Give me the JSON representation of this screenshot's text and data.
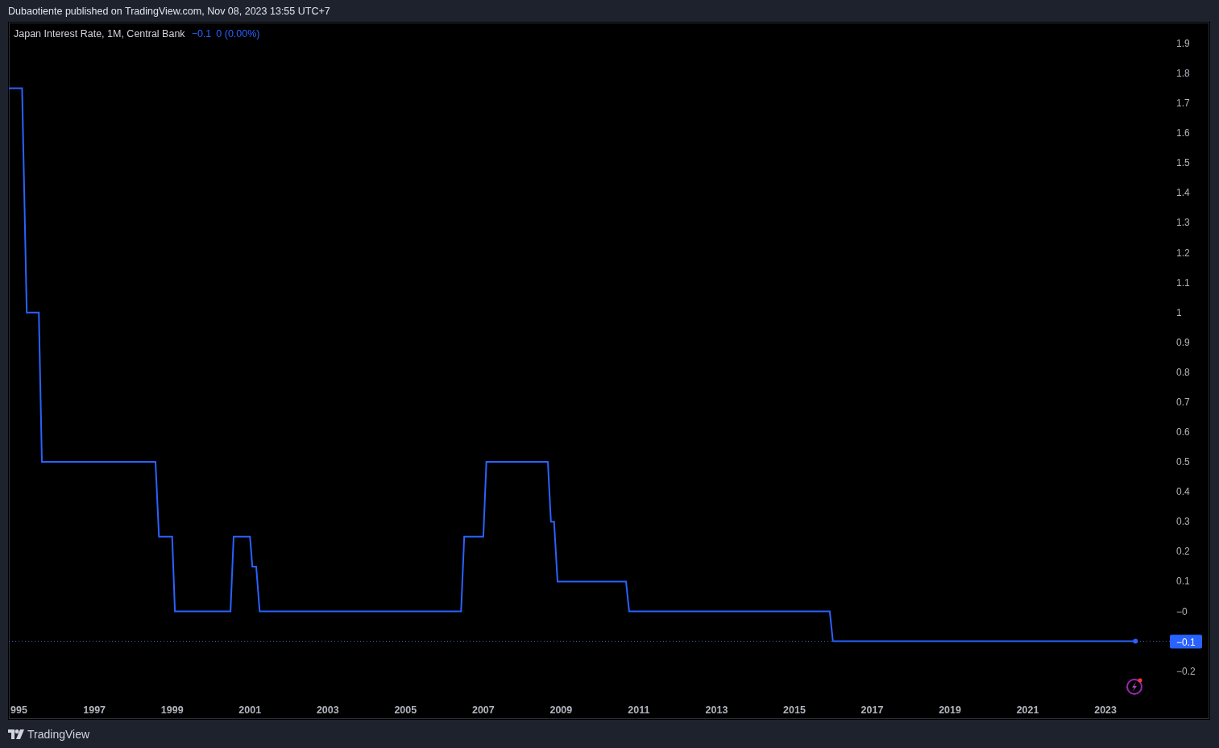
{
  "header": {
    "text": "Dubaotiente published on TradingView.com, Nov 08, 2023 13:55 UTC+7"
  },
  "legend": {
    "title": "Japan Interest Rate, 1M, Central Bank",
    "value": "−0.1",
    "change": "0 (0.00%)"
  },
  "chart": {
    "price_label": "−0.1",
    "cut_tick_label": "995",
    "chart_data": {
      "type": "line",
      "x": [
        1994.8,
        1995.14,
        1995.26,
        1995.57,
        1995.65,
        1998.57,
        1998.66,
        1999.0,
        1999.07,
        2000.5,
        2000.58,
        2001.0,
        2001.06,
        2001.16,
        2001.25,
        2006.43,
        2006.51,
        2007.0,
        2007.08,
        2008.66,
        2008.74,
        2008.82,
        2008.91,
        2010.67,
        2010.75,
        2015.91,
        2015.99,
        2023.77
      ],
      "series": [
        {
          "color": "#2962ff",
          "values": [
            1.75,
            1.75,
            1.0,
            1.0,
            0.5,
            0.5,
            0.25,
            0.25,
            0,
            0,
            0.25,
            0.25,
            0.15,
            0.15,
            0,
            0,
            0.25,
            0.25,
            0.5,
            0.5,
            0.3,
            0.3,
            0.1,
            0.1,
            0,
            0,
            -0.1,
            -0.1
          ]
        }
      ],
      "xlim": [
        1994.8,
        2025.67
      ],
      "ylim": [
        -0.36,
        1.97
      ],
      "ref_lines": [
        {
          "axis": "y",
          "value": -0.1
        }
      ],
      "xticks": [
        {
          "value": 1997,
          "label": "1997"
        },
        {
          "value": 1999,
          "label": "1999"
        },
        {
          "value": 2001,
          "label": "2001"
        },
        {
          "value": 2003,
          "label": "2003"
        },
        {
          "value": 2005,
          "label": "2005"
        },
        {
          "value": 2007,
          "label": "2007"
        },
        {
          "value": 2009,
          "label": "2009"
        },
        {
          "value": 2011,
          "label": "2011"
        },
        {
          "value": 2013,
          "label": "2013"
        },
        {
          "value": 2015,
          "label": "2015"
        },
        {
          "value": 2017,
          "label": "2017"
        },
        {
          "value": 2019,
          "label": "2019"
        },
        {
          "value": 2021,
          "label": "2021"
        },
        {
          "value": 2023,
          "label": "2023"
        }
      ],
      "yticks": [
        {
          "value": 1.9,
          "label": "1.9"
        },
        {
          "value": 1.8,
          "label": "1.8"
        },
        {
          "value": 1.7,
          "label": "1.7"
        },
        {
          "value": 1.6,
          "label": "1.6"
        },
        {
          "value": 1.5,
          "label": "1.5"
        },
        {
          "value": 1.4,
          "label": "1.4"
        },
        {
          "value": 1.3,
          "label": "1.3"
        },
        {
          "value": 1.2,
          "label": "1.2"
        },
        {
          "value": 1.1,
          "label": "1.1"
        },
        {
          "value": 1,
          "label": "1"
        },
        {
          "value": 0.9,
          "label": "0.9"
        },
        {
          "value": 0.8,
          "label": "0.8"
        },
        {
          "value": 0.7,
          "label": "0.7"
        },
        {
          "value": 0.6,
          "label": "0.6"
        },
        {
          "value": 0.5,
          "label": "0.5"
        },
        {
          "value": 0.4,
          "label": "0.4"
        },
        {
          "value": 0.3,
          "label": "0.3"
        },
        {
          "value": 0.2,
          "label": "0.2"
        },
        {
          "value": 0.1,
          "label": "0.1"
        },
        {
          "value": 0,
          "label": "−0"
        },
        {
          "value": -0.2,
          "label": "−0.2"
        }
      ]
    }
  },
  "footer": {
    "brand": "TradingView"
  }
}
